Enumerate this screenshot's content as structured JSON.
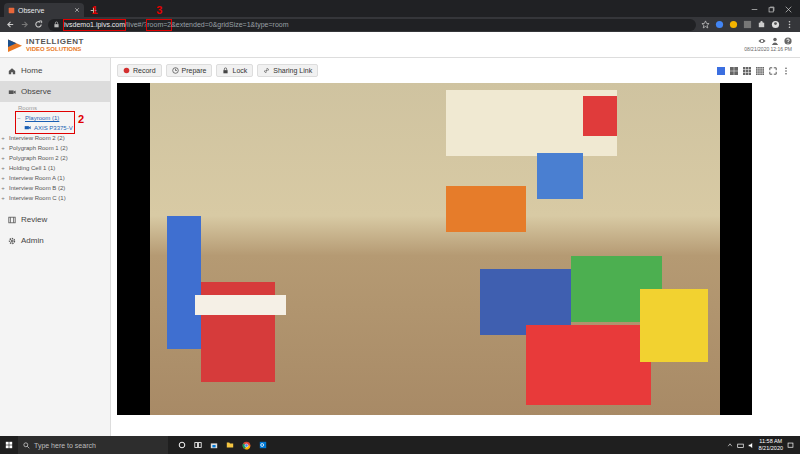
{
  "browser": {
    "tab_title": "Observe",
    "url": [
      {
        "text": "ivsdemo1.ipivs.com",
        "annotation": "1"
      },
      {
        "text": "/live#/?"
      },
      {
        "text": "room=2",
        "annotation": "3"
      },
      {
        "text": "&extended=0&gridSize=1&type=room"
      }
    ]
  },
  "header": {
    "logo_top": "INTELLIGENT",
    "logo_bottom": "VIDEO SOLUTIONS",
    "datetime": "08/21/2020 12:16 PM"
  },
  "sidebar": {
    "items": [
      {
        "label": "Home",
        "kind": "home",
        "selected": false
      },
      {
        "label": "Observe",
        "kind": "observe",
        "selected": true
      }
    ],
    "rooms_label": "Rooms",
    "rooms": [
      {
        "label": "Playroom (1)",
        "toggle": "−",
        "expanded": true,
        "annotation": "2",
        "children": [
          "AXIS P3375-V"
        ]
      },
      {
        "label": "Interview Room 2 (2)",
        "toggle": "+",
        "expanded": false
      },
      {
        "label": "Polygraph Room 1 (2)",
        "toggle": "+",
        "expanded": false
      },
      {
        "label": "Polygraph Room 2 (2)",
        "toggle": "+",
        "expanded": false
      },
      {
        "label": "Holding Cell 1 (1)",
        "toggle": "+",
        "expanded": false
      },
      {
        "label": "Interview Room A (1)",
        "toggle": "+",
        "expanded": false
      },
      {
        "label": "Interview Room B (2)",
        "toggle": "+",
        "expanded": false
      },
      {
        "label": "Interview Room C (1)",
        "toggle": "+",
        "expanded": false
      }
    ],
    "bottom_items": [
      {
        "label": "Review",
        "kind": "review",
        "selected": false
      },
      {
        "label": "Admin",
        "kind": "admin",
        "selected": false
      }
    ]
  },
  "toolbar": {
    "buttons": [
      {
        "label": "Record",
        "kind": "record"
      },
      {
        "label": "Prepare",
        "kind": "prepare"
      },
      {
        "label": "Lock",
        "kind": "lock"
      },
      {
        "label": "Sharing Link",
        "kind": "link"
      }
    ]
  },
  "layouts": [
    {
      "selected": true
    },
    {
      "selected": false
    },
    {
      "selected": false
    },
    {
      "selected": false
    }
  ],
  "taskbar": {
    "search_placeholder": "Type here to search",
    "time": "11:58 AM",
    "date": "8/21/2020"
  }
}
